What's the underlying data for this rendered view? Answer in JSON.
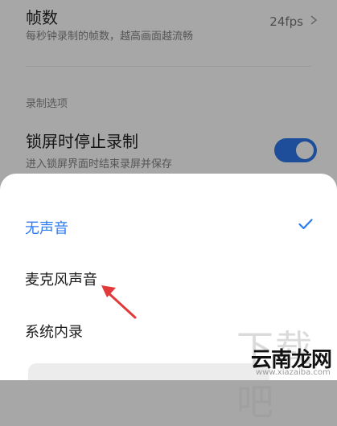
{
  "settings": {
    "frame_rate": {
      "title": "帧数",
      "subtitle": "每秒钟录制的帧数，越高画面越流畅",
      "value": "24fps"
    },
    "section_label": "录制选项",
    "lock_stop": {
      "title": "锁屏时停止录制",
      "subtitle": "进入锁屏界面时结束录屏并保存",
      "enabled": true
    }
  },
  "sound_sheet": {
    "options": [
      {
        "label": "无声音",
        "selected": true
      },
      {
        "label": "麦克风声音",
        "selected": false
      },
      {
        "label": "系统内录",
        "selected": false
      }
    ]
  },
  "watermark": {
    "big": "下载吧",
    "logo": "云南龙网",
    "url": "www.xiazaiba.com"
  },
  "colors": {
    "accent": "#2d7bf1",
    "toggle": "#1e4d9a",
    "arrow": "#e23a3a"
  }
}
